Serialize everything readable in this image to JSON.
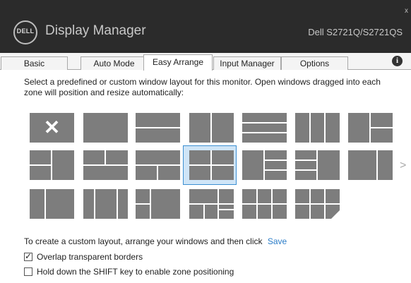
{
  "header": {
    "logo_text": "DELL",
    "title": "Display Manager",
    "model": "Dell S2721Q/S2721QS",
    "close_label": "x"
  },
  "tabs": [
    {
      "label": "Basic",
      "active": false
    },
    {
      "label": "Auto Mode",
      "active": false
    },
    {
      "label": "Easy Arrange",
      "active": true
    },
    {
      "label": "Input Manager",
      "active": false
    },
    {
      "label": "Options",
      "active": false
    }
  ],
  "info_label": "i",
  "description": "Select a predefined or custom window layout for this monitor.  Open windows dragged into each zone will position and resize automatically:",
  "layouts": {
    "selected_index": 10,
    "next_arrow": ">",
    "custom_tile_glyph": "✕"
  },
  "custom": {
    "text": "To create a custom layout, arrange your windows and then click",
    "save_label": "Save"
  },
  "options": [
    {
      "label": "Overlap transparent borders",
      "checked": true
    },
    {
      "label": "Hold down the SHIFT key to enable zone positioning",
      "checked": false
    }
  ],
  "colors": {
    "header_bg": "#2b2b2b",
    "tile": "#7d7d7d",
    "selection_border": "#3c8fd2",
    "selection_fill": "#cfe5f7",
    "link": "#2a7cc7"
  }
}
